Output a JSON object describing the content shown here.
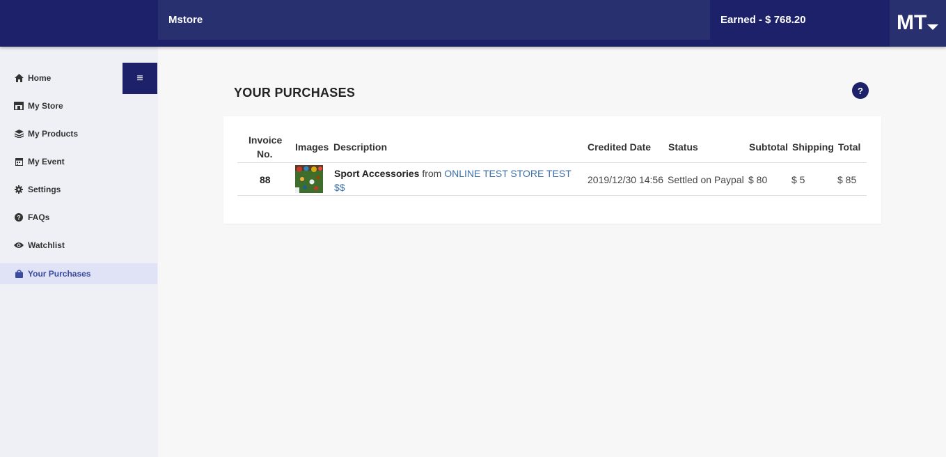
{
  "header": {
    "brand": "Mstore",
    "earned": "Earned - $ 768.20",
    "user_initials": "MT"
  },
  "sidebar": {
    "items": [
      {
        "label": "Home",
        "icon": "home-icon"
      },
      {
        "label": "My Store",
        "icon": "store-icon"
      },
      {
        "label": "My Products",
        "icon": "layers-icon"
      },
      {
        "label": "My Event",
        "icon": "calendar-icon"
      },
      {
        "label": "Settings",
        "icon": "gear-icon"
      },
      {
        "label": "FAQs",
        "icon": "question-circle-icon"
      },
      {
        "label": "Watchlist",
        "icon": "eye-icon"
      },
      {
        "label": "Your Purchases",
        "icon": "shopping-bag-icon",
        "active": true
      }
    ],
    "toggle_icon": "≡"
  },
  "main": {
    "title": "YOUR PURCHASES",
    "help_label": "?",
    "table": {
      "headers": {
        "invoice_line1": "Invoice",
        "invoice_line2": "No.",
        "images": "Images",
        "description": "Description",
        "credited_date": "Credited Date",
        "status": "Status",
        "subtotal": "Subtotal",
        "shipping": "Shipping",
        "total": "Total"
      },
      "rows": [
        {
          "invoice": "88",
          "product": "Sport Accessories",
          "from_text": "from",
          "store": "ONLINE TEST STORE TEST $$",
          "credited_date": "2019/12/30 14:56",
          "status": "Settled on Paypal",
          "subtotal": "$ 80",
          "shipping": "$ 5",
          "total": "$ 85"
        }
      ]
    }
  },
  "colors": {
    "navy": "#1c2169",
    "navy_light": "#283070",
    "sidebar_bg": "#eff0f6",
    "active_bg": "#dfe3f5",
    "link": "#3a6fa6"
  }
}
